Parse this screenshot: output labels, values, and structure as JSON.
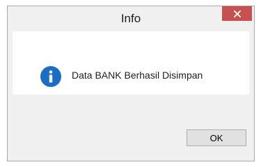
{
  "dialog": {
    "title": "Info",
    "message": "Data BANK Berhasil Disimpan",
    "icon": "info-icon",
    "ok_label": "OK"
  },
  "colors": {
    "close_button": "#c75050",
    "info_icon": "#1c6dc4",
    "window_bg": "#f0f0f0",
    "content_bg": "#ffffff"
  }
}
